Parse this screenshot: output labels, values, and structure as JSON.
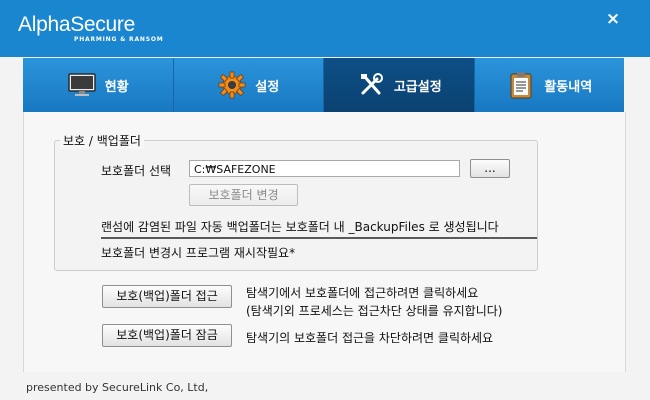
{
  "app": {
    "logo_main": "AlphaSecure",
    "logo_sub": "PHARMING & RANSOM",
    "close_label": "×"
  },
  "tabs": [
    {
      "label": "현황",
      "icon": "monitor-icon",
      "active": false
    },
    {
      "label": "설정",
      "icon": "gear-icon",
      "active": false
    },
    {
      "label": "고급설정",
      "icon": "tools-icon",
      "active": true
    },
    {
      "label": "활동내역",
      "icon": "clipboard-icon",
      "active": false
    }
  ],
  "protect_group": {
    "title": "보호 / 백업폴더",
    "folder_label": "보호폴더 선택",
    "folder_value": "C:₩SAFEZONE",
    "browse_label": "...",
    "change_label": "보호폴더 변경",
    "info_text": "랜섬에 감염된 파일 자동 백업폴더는 보호폴더 내 _BackupFiles 로 생성됩니다",
    "restart_note": "보호폴더 변경시 프로그램 재시작필요*"
  },
  "access": {
    "open_button": "보호(백업)폴더 접근",
    "open_desc_1": "탐색기에서 보호폴더에 접근하려면 클릭하세요",
    "open_desc_2": "(탐색기외 프로세스는 접근차단 상태를 유지합니다)",
    "lock_button": "보호(백업)폴더 잠금",
    "lock_desc": "탐색기의 보호폴더 접근을 차단하려면 클릭하세요"
  },
  "footer": {
    "text": "presented by SecureLink Co, Ltd,"
  },
  "colors": {
    "header_blue": "#1a86cf",
    "active_tab": "#0d4f86"
  }
}
